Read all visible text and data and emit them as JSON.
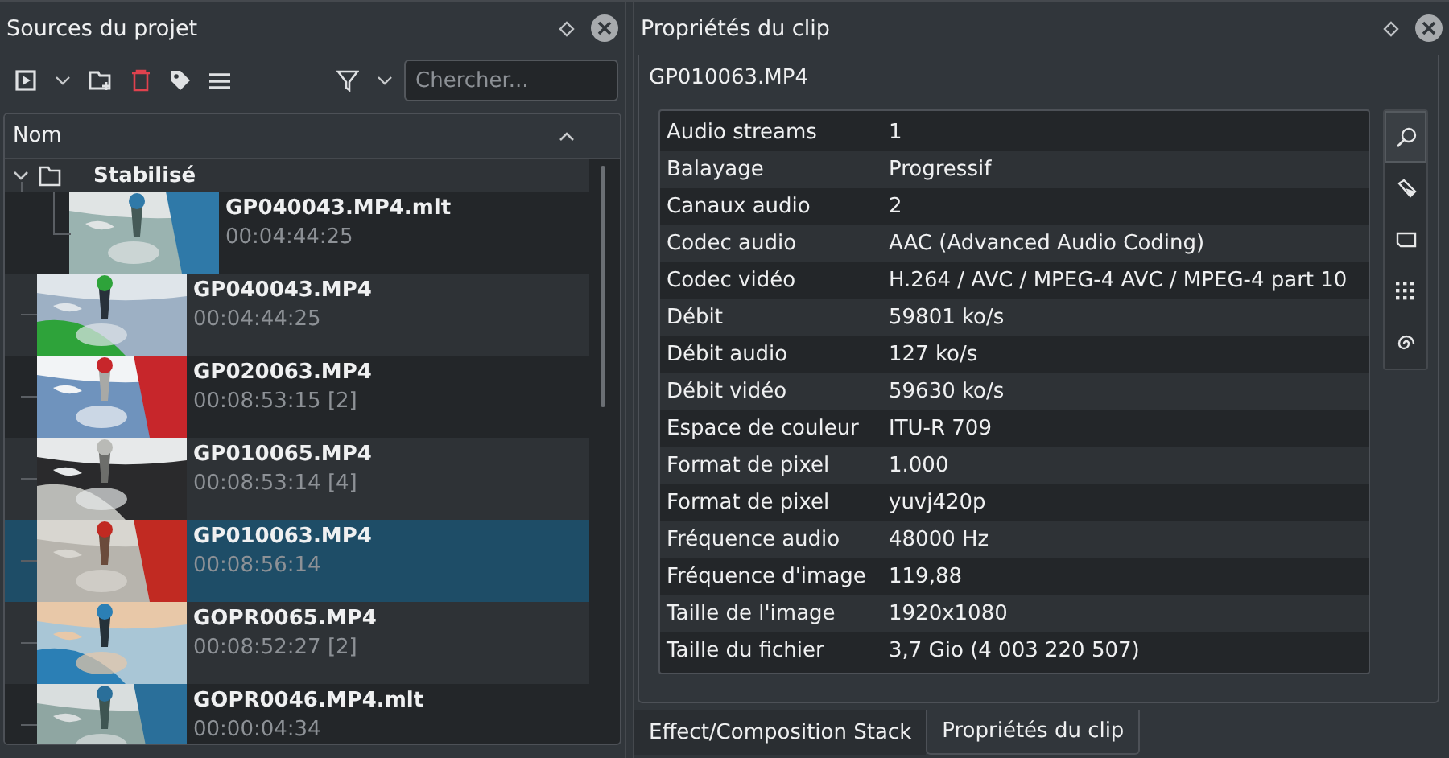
{
  "left_panel": {
    "title": "Sources du projet",
    "search": {
      "placeholder": "Chercher..."
    },
    "column_header": "Nom",
    "tree": [
      {
        "kind": "folder",
        "name": "Stabilisé",
        "expanded": true,
        "children": [
          {
            "kind": "clip",
            "name": "GP040043.MP4.mlt",
            "duration": "00:04:44:25",
            "selected": false
          }
        ]
      },
      {
        "kind": "clip",
        "name": "GP040043.MP4",
        "duration": "00:04:44:25",
        "selected": false
      },
      {
        "kind": "clip",
        "name": "GP020063.MP4",
        "duration": "00:08:53:15 [2]",
        "selected": false
      },
      {
        "kind": "clip",
        "name": "GP010065.MP4",
        "duration": "00:08:53:14 [4]",
        "selected": false
      },
      {
        "kind": "clip",
        "name": "GP010063.MP4",
        "duration": "00:08:56:14",
        "selected": true
      },
      {
        "kind": "clip",
        "name": "GOPR0065.MP4",
        "duration": "00:08:52:27 [2]",
        "selected": false
      },
      {
        "kind": "clip",
        "name": "GOPR0046.MP4.mlt",
        "duration": "00:00:04:34",
        "selected": false
      }
    ]
  },
  "right_panel": {
    "title": "Propriétés du clip",
    "filename": "GP010063.MP4",
    "properties": [
      {
        "label": "Audio streams",
        "value": "1"
      },
      {
        "label": "Balayage",
        "value": "Progressif"
      },
      {
        "label": "Canaux audio",
        "value": "2"
      },
      {
        "label": "Codec audio",
        "value": "AAC (Advanced Audio Coding)"
      },
      {
        "label": "Codec vidéo",
        "value": "H.264 / AVC / MPEG-4 AVC / MPEG-4 part 10"
      },
      {
        "label": "Débit",
        "value": "59801 ko/s"
      },
      {
        "label": "Débit audio",
        "value": "127 ko/s"
      },
      {
        "label": "Débit vidéo",
        "value": "59630 ko/s"
      },
      {
        "label": "Espace de couleur",
        "value": "ITU-R 709"
      },
      {
        "label": "Format de pixel",
        "value": "1.000"
      },
      {
        "label": "Format de pixel",
        "value": "yuvj420p"
      },
      {
        "label": "Fréquence audio",
        "value": "48000 Hz"
      },
      {
        "label": "Fréquence d'image",
        "value": "119,88"
      },
      {
        "label": "Taille de l'image",
        "value": "1920x1080"
      },
      {
        "label": "Taille du fichier",
        "value": "3,7 Gio (4 003 220 507)"
      }
    ],
    "side_tabs": [
      {
        "kind": "search",
        "selected": true
      },
      {
        "kind": "marker",
        "selected": false
      },
      {
        "kind": "frame",
        "selected": false
      },
      {
        "kind": "grid",
        "selected": false
      },
      {
        "kind": "spiral",
        "selected": false
      }
    ]
  },
  "bottom_tabs": [
    {
      "label": "Effect/Composition Stack",
      "selected": false
    },
    {
      "label": "Propriétés du clip",
      "selected": true
    }
  ]
}
